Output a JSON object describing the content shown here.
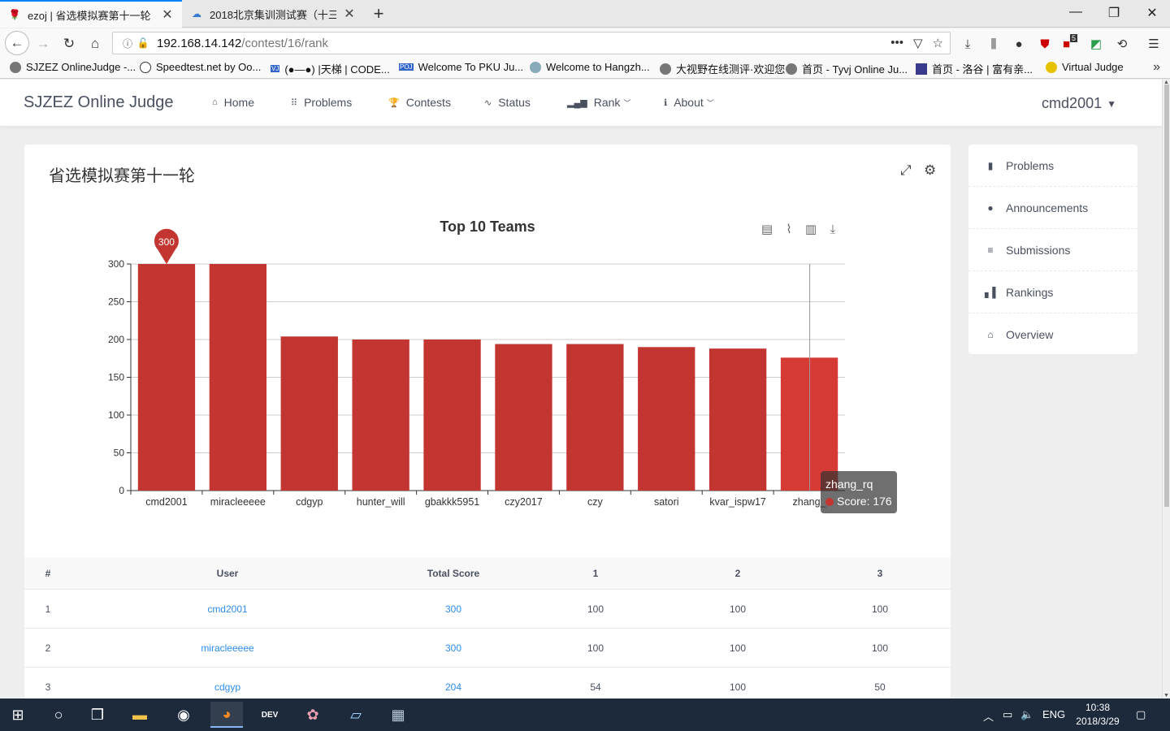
{
  "browser": {
    "tabs": [
      {
        "title": "ezoj | 省选模拟赛第十一轮",
        "active": true
      },
      {
        "title": "2018北京集训测试赛（十三）",
        "active": false
      }
    ],
    "url_host": "192.168.14.142",
    "url_path": "/contest/16/rank",
    "url_more": "•••",
    "badge_count": "5",
    "bookmarks": [
      "SJZEZ OnlineJudge -...",
      "Speedtest.net by Oo...",
      "(●—●) |天梯 | CODE...",
      "Welcome To PKU Ju...",
      "Welcome to Hangzh...",
      "大视野在线测评·欢迎您",
      "首页 - Tyvj Online Ju...",
      "首页 - 洛谷 | 富有亲...",
      "Virtual Judge"
    ],
    "bookmark_badges": {
      "vj": "VJ",
      "poj": "POJ"
    }
  },
  "site": {
    "brand": "SJZEZ Online Judge",
    "menu": {
      "home": "Home",
      "problems": "Problems",
      "contests": "Contests",
      "status": "Status",
      "rank": "Rank",
      "about": "About"
    },
    "username": "cmd2001"
  },
  "contest": {
    "title": "省选模拟赛第十一轮"
  },
  "chart_data": {
    "type": "bar",
    "title": "Top 10 Teams",
    "categories": [
      "cmd2001",
      "miracleeeee",
      "cdgyp",
      "hunter_will",
      "gbakkk5951",
      "czy2017",
      "czy",
      "satori",
      "kvar_ispw17",
      "zhang_rq"
    ],
    "tick_labels": [
      "cmd2001",
      "miracleeeee",
      "cdgyp",
      "hunter_will",
      "gbakkk5951",
      "czy2017",
      "czy",
      "satori",
      "kvar_ispw17",
      "zhang_"
    ],
    "values": [
      300,
      300,
      204,
      200,
      200,
      194,
      194,
      190,
      188,
      176
    ],
    "ylim": [
      0,
      300
    ],
    "yticks": [
      "0",
      "50",
      "100",
      "150",
      "200",
      "250",
      "300"
    ],
    "max_marker": "300",
    "bar_color": "#c23531",
    "highlight_color": "#d63a35",
    "highlight_index": 9,
    "tooltip": {
      "name": "zhang_rq",
      "text": "Score: 176"
    }
  },
  "table": {
    "headers": {
      "rank": "#",
      "user": "User",
      "total": "Total Score",
      "p1": "1",
      "p2": "2",
      "p3": "3"
    },
    "rows": [
      {
        "rank": "1",
        "user": "cmd2001",
        "total": "300",
        "p1": "100",
        "p2": "100",
        "p3": "100"
      },
      {
        "rank": "2",
        "user": "miracleeeee",
        "total": "300",
        "p1": "100",
        "p2": "100",
        "p3": "100"
      },
      {
        "rank": "3",
        "user": "cdgyp",
        "total": "204",
        "p1": "54",
        "p2": "100",
        "p3": "50"
      }
    ]
  },
  "sidebar": {
    "items": [
      "Problems",
      "Announcements",
      "Submissions",
      "Rankings",
      "Overview"
    ]
  },
  "taskbar": {
    "lang": "ENG",
    "time": "10:38",
    "date": "2018/3/29",
    "dev_label": "DEV"
  },
  "colors": {
    "accent": "#2d8cf0",
    "bar": "#c23531",
    "taskbar": "#1c2a3c"
  }
}
